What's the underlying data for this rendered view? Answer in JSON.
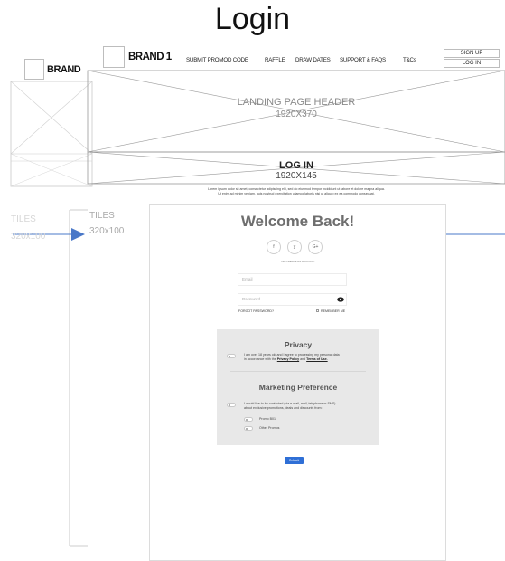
{
  "page": {
    "title": "Login"
  },
  "header": {
    "brand_main": "BRAND 1",
    "brand_side": "BRAND",
    "nav": [
      {
        "label": "SUBMIT PROMOD CODE"
      },
      {
        "label": "RAFFLE"
      },
      {
        "label": "DRAW DATES"
      },
      {
        "label": "SUPPORT & FAQS"
      },
      {
        "label": "T&Cs"
      }
    ],
    "sign_up": "SIGN UP",
    "log_in": "LOG  IN"
  },
  "landing_header": {
    "label": "LANDING PAGE HEADER",
    "size": "1920X370"
  },
  "login_banner": {
    "label": "LOG IN",
    "size": "1920X145"
  },
  "intro": {
    "line1": "Lorem ipsum dolor sit amet, consectetur adipiscing elit, sed do eiusmod tempor incididunt ut labore et dolore magna aliqua.",
    "line2": "Ut enim ad minim veniam, quis nostrud exercitation ullamco laboris nisi ut aliquip ex ea commodo consequat."
  },
  "tiles": {
    "left": {
      "label": "TILES",
      "size": "320x100"
    },
    "right": {
      "label": "TILES",
      "size": "320x100"
    }
  },
  "login_form": {
    "heading": "Welcome Back!",
    "social": [
      {
        "icon": "facebook-icon",
        "glyph": "f"
      },
      {
        "icon": "twitter-icon",
        "glyph": "y"
      },
      {
        "icon": "google-plus-icon",
        "glyph": "G+"
      }
    ],
    "social_caption": "OR CREATE AN ACCOUNT",
    "email_placeholder": "Email",
    "password_placeholder": "Password",
    "forgot_label": "FORGOT PASSWORD?",
    "remember_label": "REMEMBER ME",
    "submit_label": "Submit"
  },
  "privacy": {
    "heading": "Privacy",
    "text_line1": "I am over 18 years old and I agree to processing my personal data",
    "text_line2_pre": "in accordance with the",
    "privacy_link": "Privacy Policy",
    "text_and": "and",
    "terms_link": "Terms of Use."
  },
  "marketing": {
    "heading": "Marketing Preference",
    "text_line1": "I would like to be contacted (via e-mail, mail, telephone or SMS)",
    "text_line2": "about exclusive promotions, deals and discounts from:",
    "options": [
      {
        "label": "Promo B01"
      },
      {
        "label": "Other Promos"
      }
    ]
  },
  "colors": {
    "accent": "#2f6fd6",
    "panel": "#e8e8e8",
    "wire": "#bdbdbd"
  }
}
